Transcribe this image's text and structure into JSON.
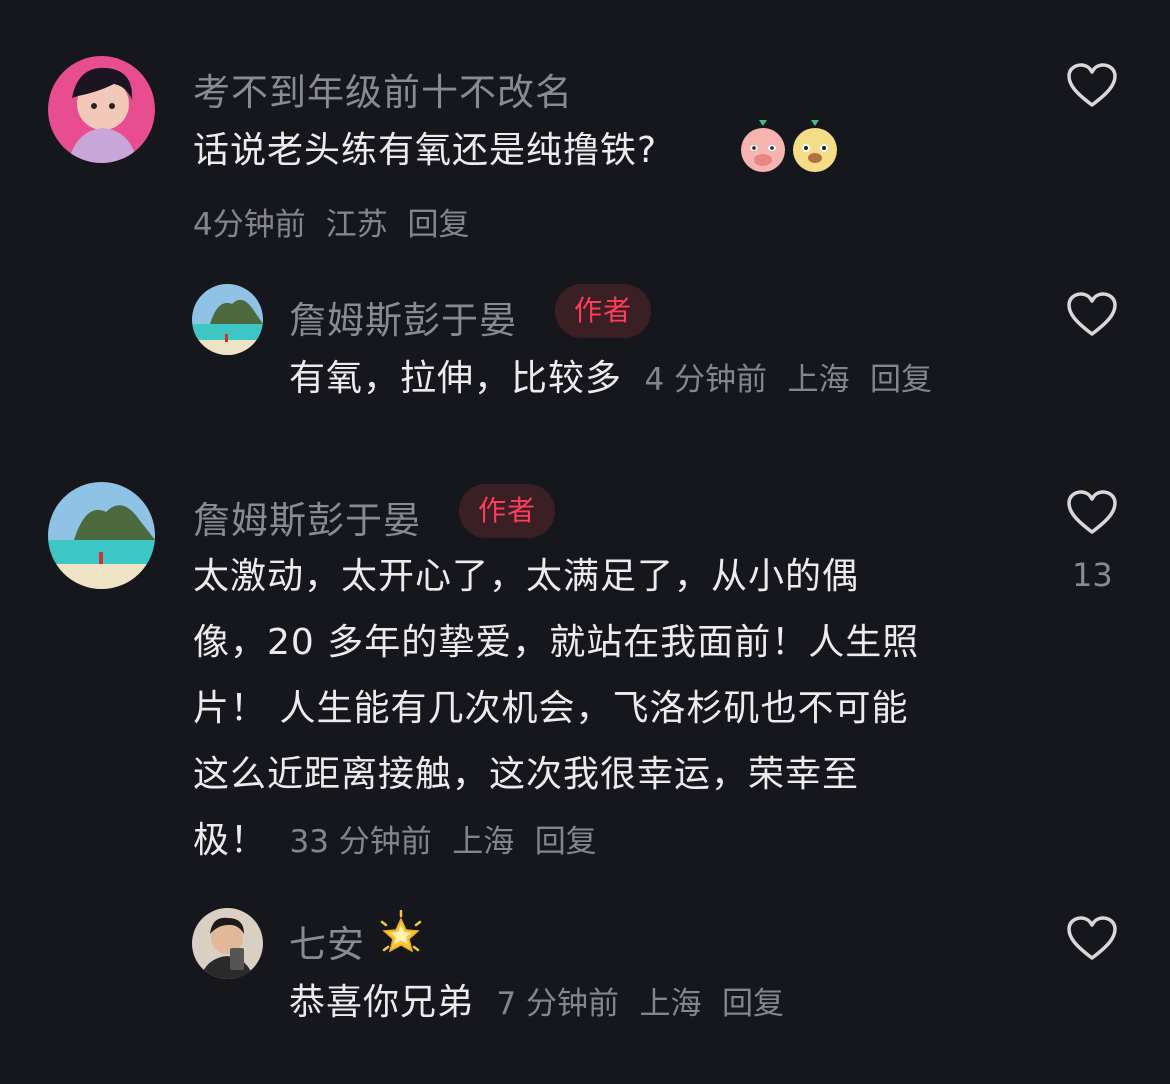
{
  "comments": [
    {
      "username": "考不到年级前十不改名",
      "text": "话说老头练有氧还是纯撸铁?",
      "time": "4分钟前",
      "location": "江苏",
      "reply_label": "回复",
      "like_count": ""
    },
    {
      "username": "詹姆斯彭于晏",
      "badge": "作者",
      "text": "有氧，拉伸，比较多",
      "time": "4 分钟前",
      "location": "上海",
      "reply_label": "回复",
      "like_count": ""
    },
    {
      "username": "詹姆斯彭于晏",
      "badge": "作者",
      "text_lines": [
        "太激动，太开心了，太满足了，从小的偶",
        "像，20 多年的挚爱，就站在我面前！人生照",
        "片！ 人生能有几次机会，飞洛杉矶也不可能",
        "这么近距离接触，这次我很幸运，荣幸至",
        "极！"
      ],
      "time": "33 分钟前",
      "location": "上海",
      "reply_label": "回复",
      "like_count": "13"
    },
    {
      "username": "七安",
      "text": "恭喜你兄弟",
      "time": "7 分钟前",
      "location": "上海",
      "reply_label": "回复",
      "like_count": ""
    }
  ],
  "icons": {
    "like": "heart-outline-icon",
    "emoji_1": "shy-face-emoji",
    "emoji_2": "happy-face-emoji",
    "star": "glowing-star-emoji"
  },
  "colors": {
    "background": "#16161d",
    "author_badge_text": "#ff3d5b",
    "author_badge_bg": "#3a2025",
    "username": "#8a8a92",
    "meta": "#85858d"
  }
}
